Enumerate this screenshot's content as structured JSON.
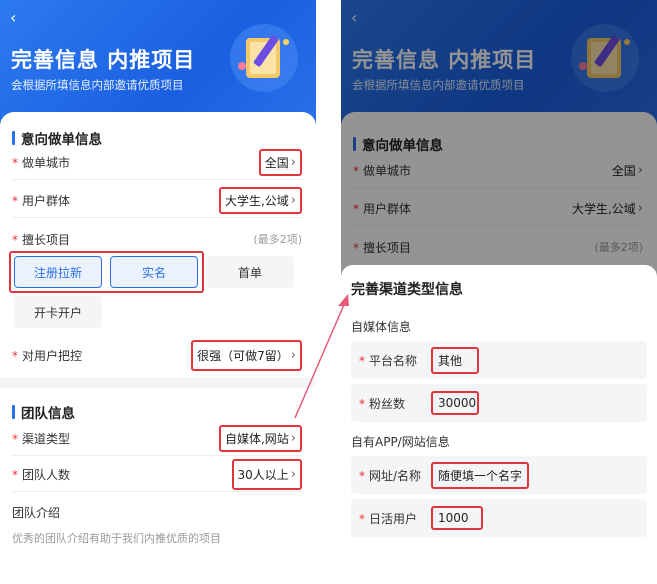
{
  "header": {
    "back_icon": "‹",
    "title": "完善信息 内推项目",
    "subtitle": "会根据所填信息内部邀请优质项目"
  },
  "intent": {
    "section_title": "意向做单信息",
    "city": {
      "star": "*",
      "label": "做单城市",
      "value": "全国"
    },
    "user_group": {
      "star": "*",
      "label": "用户群体",
      "value": "大学生,公域"
    },
    "skills": {
      "star": "*",
      "label": "擅长项目",
      "hint": "(最多2项)",
      "options": [
        "注册拉新",
        "实名",
        "首单",
        "开卡开户"
      ],
      "selected": [
        "注册拉新",
        "实名"
      ]
    },
    "user_control": {
      "star": "*",
      "label": "对用户把控",
      "value": "很强（可做7留）"
    }
  },
  "team": {
    "section_title": "团队信息",
    "channel_type": {
      "star": "*",
      "label": "渠道类型",
      "value": "自媒体,网站"
    },
    "team_size": {
      "star": "*",
      "label": "团队人数",
      "value": "30人以上"
    },
    "intro": {
      "label": "团队介绍",
      "placeholder": "优秀的团队介绍有助于我们内推优质的项目"
    }
  },
  "sheet": {
    "title": "完善渠道类型信息",
    "media_group": "自媒体信息",
    "platform": {
      "star": "*",
      "label": "平台名称",
      "value": "其他"
    },
    "fans": {
      "star": "*",
      "label": "粉丝数",
      "value": "30000"
    },
    "app_group": "自有APP/网站信息",
    "site": {
      "star": "*",
      "label": "网址/名称",
      "value": "随便填一个名字"
    },
    "dau": {
      "star": "*",
      "label": "日活用户",
      "value": "1000"
    }
  },
  "colors": {
    "accent": "#2b6fe8",
    "highlight": "#e0353d",
    "required": "#e33333"
  }
}
